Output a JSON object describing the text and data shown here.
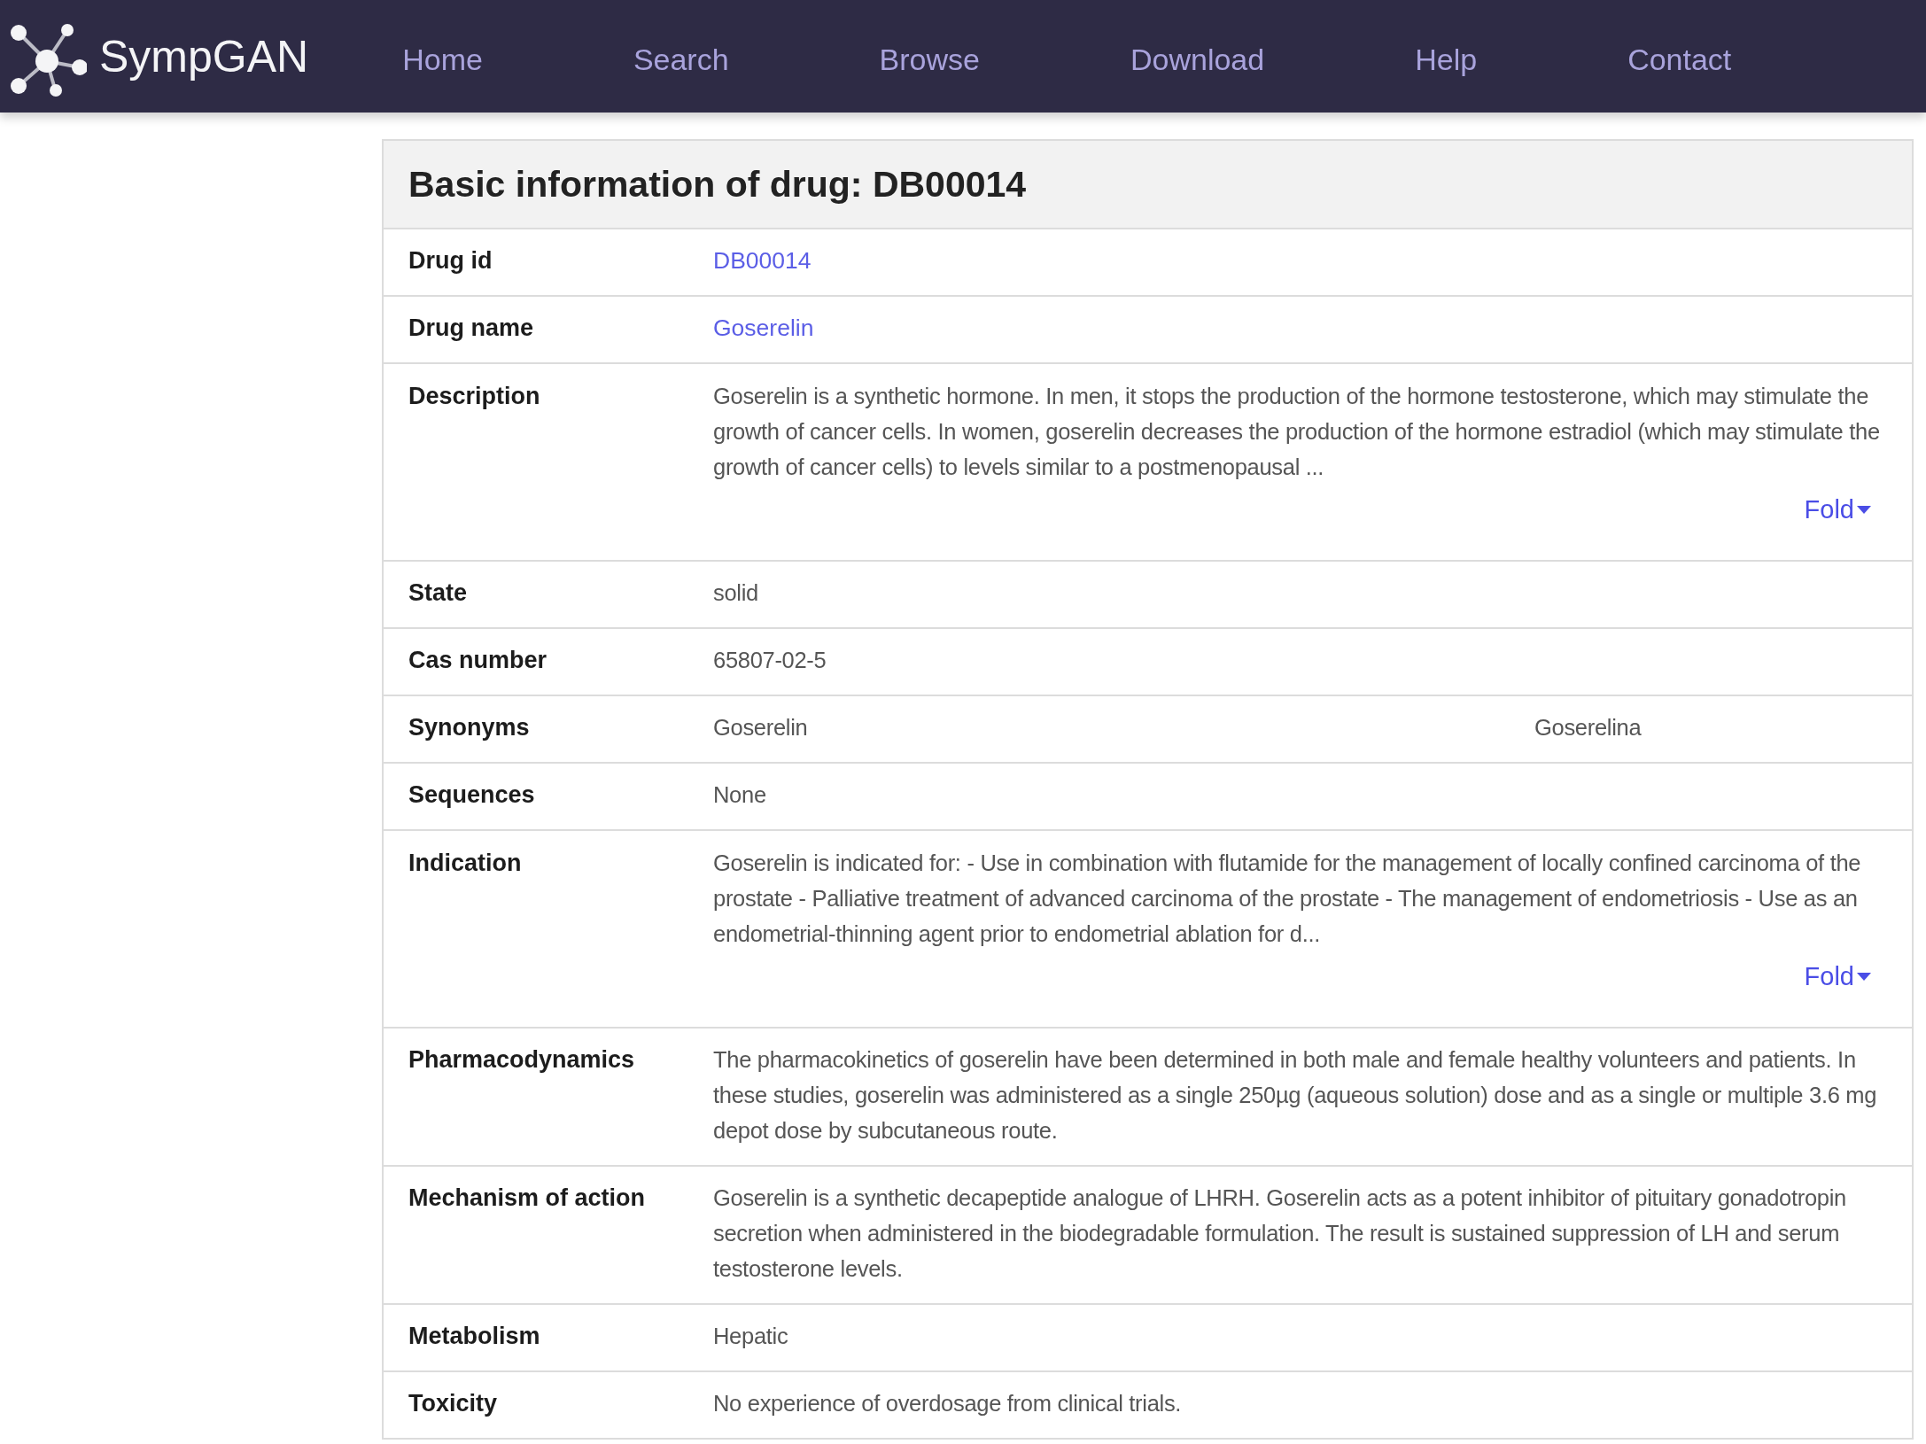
{
  "brand": "SympGAN",
  "nav": [
    "Home",
    "Search",
    "Browse",
    "Download",
    "Help",
    "Contact"
  ],
  "panel": {
    "title": "Basic information of drug: DB00014",
    "rows": [
      {
        "kind": "link",
        "label": "Drug id",
        "value": "DB00014"
      },
      {
        "kind": "link",
        "label": "Drug name",
        "value": "Goserelin"
      },
      {
        "kind": "folded",
        "label": "Description",
        "value": "Goserelin is a synthetic hormone. In men, it stops the production of the hormone testosterone, which may stimulate the growth of cancer cells. In women, goserelin decreases the production of the hormone estradiol (which may stimulate the growth of cancer cells) to levels similar to a postmenopausal ...",
        "fold": "Fold"
      },
      {
        "kind": "text",
        "label": "State",
        "value": "solid"
      },
      {
        "kind": "text",
        "label": "Cas number",
        "value": "65807-02-5"
      },
      {
        "kind": "pair",
        "label": "Synonyms",
        "values": [
          "Goserelin",
          "Goserelina"
        ]
      },
      {
        "kind": "text",
        "label": "Sequences",
        "value": "None"
      },
      {
        "kind": "folded",
        "label": "Indication",
        "value": "Goserelin is indicated for: - Use in combination with flutamide for the management of locally confined carcinoma of the prostate - Palliative treatment of advanced carcinoma of the prostate - The management of endometriosis - Use as an endometrial-thinning agent prior to endometrial ablation for d...",
        "fold": "Fold"
      },
      {
        "kind": "text",
        "label": "Pharmacodynamics",
        "value": "The pharmacokinetics of goserelin have been determined in both male and female healthy volunteers and patients. In these studies, goserelin was administered as a single 250µg (aqueous solution) dose and as a single or multiple 3.6 mg depot dose by subcutaneous route."
      },
      {
        "kind": "text",
        "label": "Mechanism of action",
        "value": "Goserelin is a synthetic decapeptide analogue of LHRH. Goserelin acts as a potent inhibitor of pituitary gonadotropin secretion when administered in the biodegradable formulation. The result is sustained suppression of LH and serum testosterone levels."
      },
      {
        "kind": "text",
        "label": "Metabolism",
        "value": "Hepatic"
      },
      {
        "kind": "text",
        "label": "Toxicity",
        "value": "No experience of overdosage from clinical trials."
      }
    ]
  }
}
